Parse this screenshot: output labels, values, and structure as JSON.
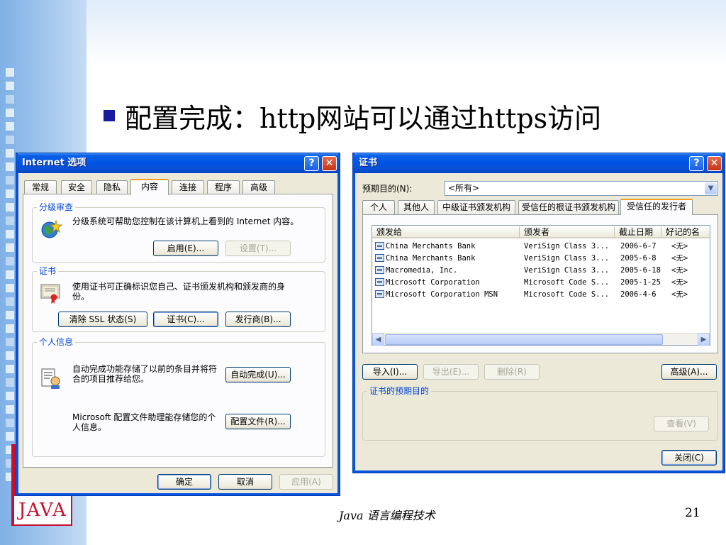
{
  "slide": {
    "title": "配置完成：http网站可以通过https访问",
    "footer": "Java 语言编程技术",
    "page_number": "21",
    "logo": "JAVA"
  },
  "internet_options": {
    "title": "Internet 选项",
    "tabs": [
      {
        "label": "常规"
      },
      {
        "label": "安全"
      },
      {
        "label": "隐私"
      },
      {
        "label": "内容",
        "active": true
      },
      {
        "label": "连接"
      },
      {
        "label": "程序"
      },
      {
        "label": "高级"
      }
    ],
    "content_advisor": {
      "group_label": "分级审查",
      "description": "分级系统可帮助您控制在该计算机上看到的 Internet 内容。",
      "enable_button": "启用(E)...",
      "settings_button": "设置(T)..."
    },
    "certificates": {
      "group_label": "证书",
      "description": "使用证书可正确标识您自己、证书颁发机构和颁发商的身份。",
      "clear_ssl_button": "清除 SSL 状态(S)",
      "certificates_button": "证书(C)...",
      "publishers_button": "发行商(B)..."
    },
    "personal_info": {
      "group_label": "个人信息",
      "autocomplete_text": "自动完成功能存储了以前的条目并将符合的项目推荐给您。",
      "autocomplete_button": "自动完成(U)...",
      "profile_text": "Microsoft 配置文件助理能存储您的个人信息。",
      "profile_button": "配置文件(R)..."
    },
    "ok_button": "确定",
    "cancel_button": "取消",
    "apply_button": "应用(A)"
  },
  "certificates_dialog": {
    "title": "证书",
    "purpose_label": "预期目的(N):",
    "purpose_value": "<所有>",
    "tabs": [
      {
        "label": "个人"
      },
      {
        "label": "其他人"
      },
      {
        "label": "中级证书颁发机构"
      },
      {
        "label": "受信任的根证书颁发机构"
      },
      {
        "label": "受信任的发行者",
        "active": true
      }
    ],
    "columns": [
      "颁发给",
      "颁发者",
      "截止日期",
      "好记的名"
    ],
    "rows": [
      {
        "issued_to": "China Merchants Bank",
        "issued_by": "VeriSign Class 3...",
        "expires": "2006-6-7",
        "friendly": "<无>"
      },
      {
        "issued_to": "China Merchants Bank",
        "issued_by": "VeriSign Class 3...",
        "expires": "2005-6-8",
        "friendly": "<无>"
      },
      {
        "issued_to": "Macromedia, Inc.",
        "issued_by": "VeriSign Class 3...",
        "expires": "2005-6-18",
        "friendly": "<无>"
      },
      {
        "issued_to": "Microsoft Corporation",
        "issued_by": "Microsoft Code S...",
        "expires": "2005-1-25",
        "friendly": "<无>"
      },
      {
        "issued_to": "Microsoft Corporation MSN",
        "issued_by": "Microsoft Code S...",
        "expires": "2006-4-6",
        "friendly": "<无>"
      }
    ],
    "import_button": "导入(I)...",
    "export_button": "导出(E)...",
    "remove_button": "删除(R)",
    "advanced_button": "高级(A)...",
    "purposes_group_label": "证书的预期目的",
    "view_button": "查看(V)",
    "close_button": "关闭(C)"
  },
  "colors": {
    "titlebar": "#0054e3",
    "window_face": "#ece9d8",
    "group_label": "#0046d5",
    "tab_highlight": "#f4a01e"
  }
}
